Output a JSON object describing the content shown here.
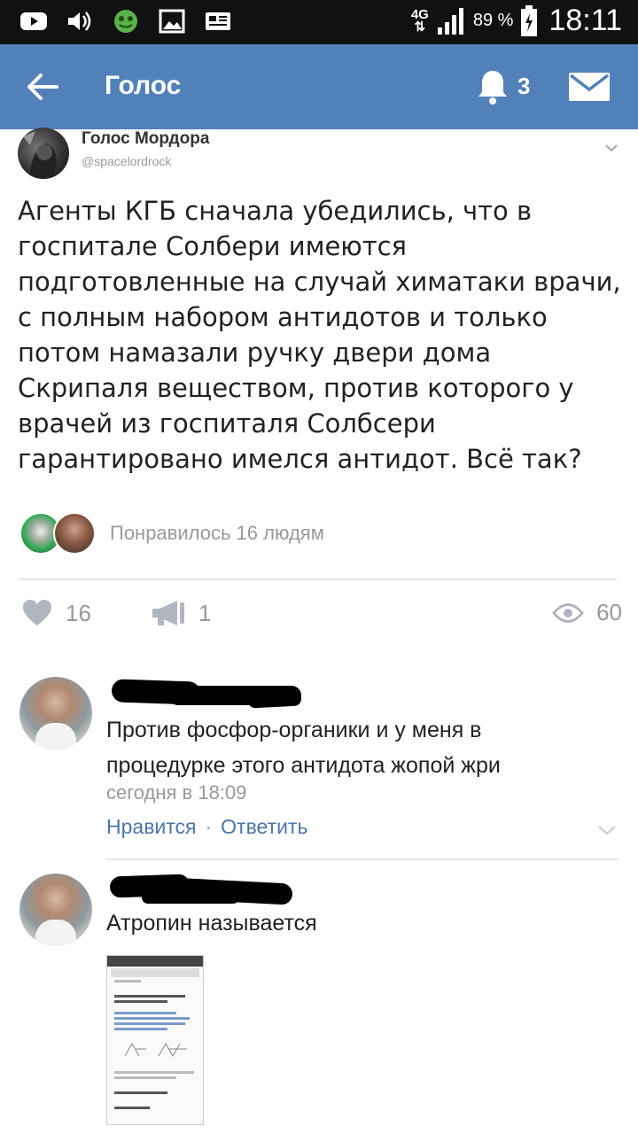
{
  "status_bar": {
    "network": "4G",
    "battery": "89 %",
    "time": "18:11"
  },
  "header": {
    "title": "Голос",
    "notifications_count": "3"
  },
  "post": {
    "author": "Голос Мордора",
    "handle": "@spacelordrock",
    "text": "Агенты КГБ сначала убедились, что в\nгоспитале Солбери имеются\nподготовленные на случай химатаки врачи,\nс полным набором антидотов и только\nпотом намазали ручку двери дома\nСкрипаля веществом, против которого у\nврачей из госпиталя Солбсери\nгарантировано имелся антидот. Всё так?",
    "likes_summary": "Понравилось 16 людям",
    "likes": "16",
    "shares": "1",
    "views": "60"
  },
  "comments": [
    {
      "text": "Против фосфор-органики и у меня в\nпроцедурке этого антидота жопой жри",
      "time": "сегодня в 18:09",
      "like_label": "Нравится",
      "reply_label": "Ответить"
    },
    {
      "text": "Атропин называется"
    }
  ],
  "colors": {
    "header_bg": "#5181b8",
    "link": "#4a76a8",
    "muted": "#999999"
  }
}
